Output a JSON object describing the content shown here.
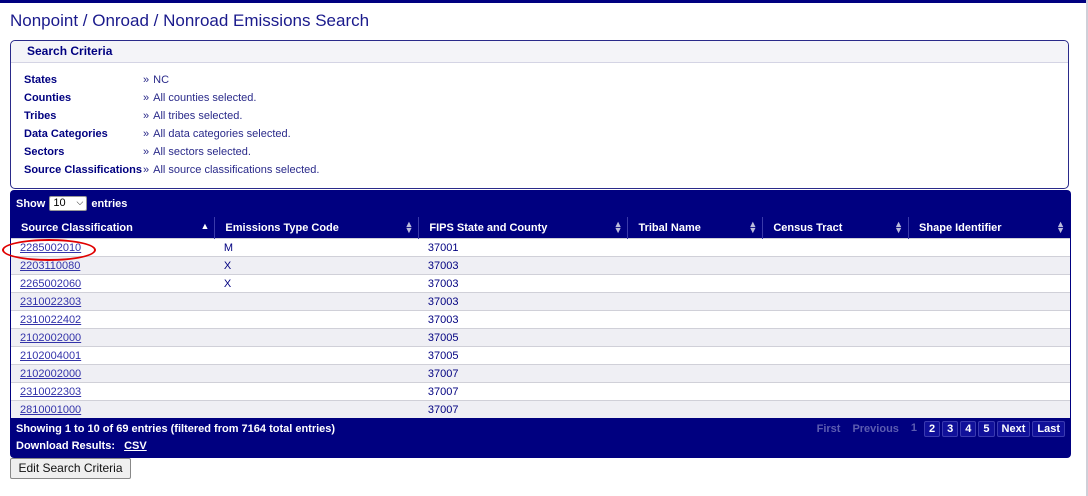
{
  "page": {
    "title": "Nonpoint / Onroad / Nonroad Emissions Search"
  },
  "criteria": {
    "heading": "Search Criteria",
    "rows": [
      {
        "label": "States",
        "value": "NC"
      },
      {
        "label": "Counties",
        "value": "All counties selected."
      },
      {
        "label": "Tribes",
        "value": "All tribes selected."
      },
      {
        "label": "Data Categories",
        "value": "All data categories selected."
      },
      {
        "label": "Sectors",
        "value": "All sectors selected."
      },
      {
        "label": "Source Classifications",
        "value": "All source classifications selected."
      }
    ],
    "arrow": "»"
  },
  "table": {
    "show_label": "Show",
    "entries_label": "entries",
    "page_length": "10",
    "columns": [
      "Source Classification",
      "Emissions Type Code",
      "FIPS State and County",
      "Tribal Name",
      "Census Tract",
      "Shape Identifier"
    ],
    "rows": [
      [
        "2285002010",
        "M",
        "37001",
        "",
        "",
        ""
      ],
      [
        "2203110080",
        "X",
        "37003",
        "",
        "",
        ""
      ],
      [
        "2265002060",
        "X",
        "37003",
        "",
        "",
        ""
      ],
      [
        "2310022303",
        "",
        "37003",
        "",
        "",
        ""
      ],
      [
        "2310022402",
        "",
        "37003",
        "",
        "",
        ""
      ],
      [
        "2102002000",
        "",
        "37005",
        "",
        "",
        ""
      ],
      [
        "2102004001",
        "",
        "37005",
        "",
        "",
        ""
      ],
      [
        "2102002000",
        "",
        "37007",
        "",
        "",
        ""
      ],
      [
        "2310022303",
        "",
        "37007",
        "",
        "",
        ""
      ],
      [
        "2810001000",
        "",
        "37007",
        "",
        "",
        ""
      ]
    ],
    "info": "Showing 1 to 10 of 69 entries (filtered from 7164 total entries)",
    "download_label": "Download Results:",
    "download_csv": "CSV"
  },
  "pager": {
    "first": "First",
    "previous": "Previous",
    "pages": [
      "1",
      "2",
      "3",
      "4",
      "5"
    ],
    "current": "1",
    "next": "Next",
    "last": "Last"
  },
  "actions": {
    "edit_label": "Edit Search Criteria"
  },
  "colors": {
    "primary": "#000080",
    "annotation": "#e00000"
  }
}
